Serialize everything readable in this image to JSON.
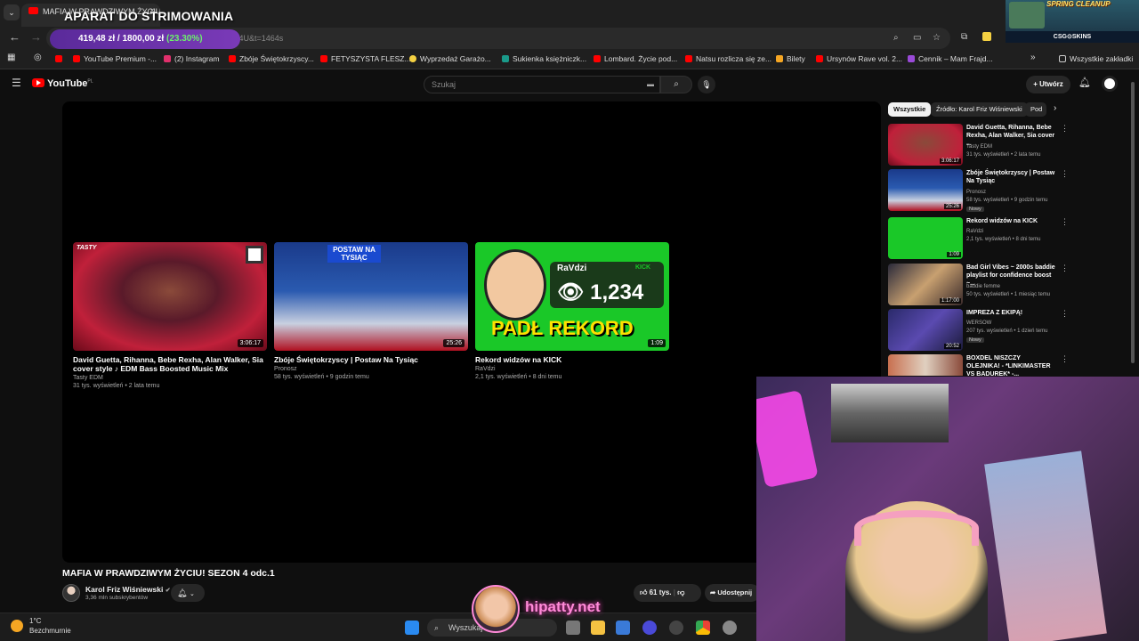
{
  "overlay": {
    "stream_title": "APARAT DO STRIMOWANIA",
    "price": "419,48 zł",
    "target": "1800,00 zł",
    "percent": "(23.30%)",
    "progress": 0.233
  },
  "browser": {
    "tab_title": "MAFIA W PRAWDZIWYM ŻYCIU!",
    "tab_close": "×",
    "url_fragment": "jmaqRv4U&t=1464s",
    "bookmarks": [
      {
        "label": "YouTube Premium -...",
        "color": "#ff0000"
      },
      {
        "label": "(2) Instagram",
        "color": "#e1306c"
      },
      {
        "label": "Zbóje Świętokrzyscy...",
        "color": "#ff0000"
      },
      {
        "label": "FETYSZYSTA FLESZ...",
        "color": "#ff0000"
      },
      {
        "label": "Wyprzedaż Garażo...",
        "color": "#f5d142"
      },
      {
        "label": "Sukienka księżniczk...",
        "color": "#1a9a8a"
      },
      {
        "label": "Lombard. Życie pod...",
        "color": "#ff0000"
      },
      {
        "label": "Natsu rozlicza się ze...",
        "color": "#ff0000"
      },
      {
        "label": "Bilety",
        "color": "#f5a623"
      },
      {
        "label": "Ursynów Rave vol. 2...",
        "color": "#ff0000"
      },
      {
        "label": "Cennik – Mam Frajd...",
        "color": "#9a4ad8"
      }
    ],
    "all_bookmarks": "Wszystkie zakładki"
  },
  "youtube": {
    "logo": "YouTube",
    "logo_region": "PL",
    "search_placeholder": "Szukaj",
    "create_label": "Utwórz",
    "chips": [
      "Wszystkie",
      "Źródło: Karol Friz Wiśniewski",
      "Pod"
    ],
    "endscreen": [
      {
        "title": "David Guetta, Rihanna, Bebe Rexha, Alan Walker, Sia cover style ♪ EDM Bass Boosted Music Mix",
        "channel": "Tasty EDM",
        "meta": "31 tys. wyświetleń • 2 lata temu",
        "duration": "3:06:17"
      },
      {
        "title": "Zbóje Świętokrzyscy | Postaw Na Tysiąc",
        "channel": "Pronosz",
        "meta": "58 tys. wyświetleń • 9 godzin temu",
        "duration": "25:26"
      },
      {
        "title": "Rekord widzów na KICK",
        "channel": "RaVdzi",
        "meta": "2,1 tys. wyświetleń • 8 dni temu",
        "duration": "1:09"
      }
    ],
    "thumb_texts": {
      "tasty": "TASTY",
      "postaw": "POSTAW NA TYSIĄC",
      "ravdzi": "RaVdzi",
      "kick": "KICK",
      "viewers": "1,234",
      "rekord": "PADŁ REKORD"
    },
    "video_title": "MAFIA W PRAWDZIWYM ŻYCIU! SEZON 4 odc.1",
    "channel_name": "Karol Friz Wiśniewski",
    "subscribers": "3,36 mln subskrybentów",
    "likes": "61 tys.",
    "share": "Udostępnij",
    "related": [
      {
        "title": "David Guetta, Rihanna, Bebe Rexha, Alan Walker, Sia cover ...",
        "channel": "Tasty EDM",
        "meta": "31 tys. wyświetleń • 2 lata temu",
        "duration": "3:06:17",
        "new": ""
      },
      {
        "title": "Zbóje Świętokrzyscy | Postaw Na Tysiąc",
        "channel": "Pronosz",
        "meta": "58 tys. wyświetleń • 9 godzin temu",
        "duration": "25:26",
        "new": "Nowy"
      },
      {
        "title": "Rekord widzów na KICK",
        "channel": "RaVdzi",
        "meta": "2,1 tys. wyświetleń • 8 dni temu",
        "duration": "1:09",
        "new": ""
      },
      {
        "title": "Bad Girl Vibes ~ 2000s baddie playlist for confidence boost ~...",
        "channel": "baddie femme",
        "meta": "50 tys. wyświetleń • 1 miesiąc temu",
        "duration": "1:17:00",
        "new": ""
      },
      {
        "title": "IMPREZA Z EKIPĄ!",
        "channel": "WERSOW",
        "meta": "207 tys. wyświetleń • 1 dzień temu",
        "duration": "20:52",
        "new": "Nowy"
      },
      {
        "title": "BOXDEL NISZCZY OLEJNIKA! - *LINKIMASTER VS BADUREK* -...",
        "channel": "",
        "meta": "",
        "duration": "",
        "new": ""
      }
    ]
  },
  "sponsor": {
    "headline": "SPRING CLEANUP",
    "brand": "CSG⊙SKINS"
  },
  "watermark": "hipatty.net",
  "taskbar": {
    "temperature": "1°C",
    "weather": "Bezchmurnie",
    "search": "Wyszukaj"
  },
  "colors": {
    "accent": "#ff0000",
    "pill": "#7a3ab8",
    "pct": "#6cf06c",
    "watermark": "#ff8ad8"
  }
}
